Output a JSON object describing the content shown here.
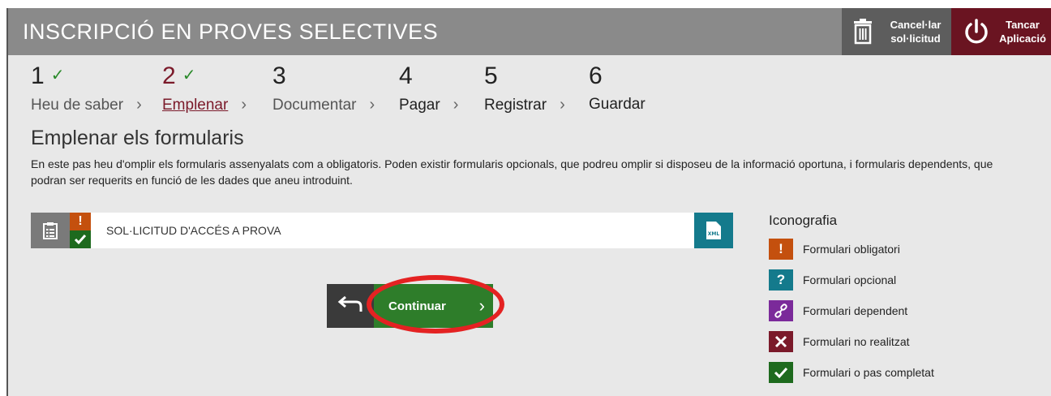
{
  "header": {
    "title": "INSCRIPCIÓ EN PROVES SELECTIVES",
    "cancel_label": "Cancel·lar sol·licitud",
    "close_label": "Tancar Aplicació",
    "colors": {
      "bar": "#8a8a8a",
      "cancel": "#5d5d5d",
      "close": "#6a1421"
    }
  },
  "steps": [
    {
      "number": "1",
      "label": "Heu de saber",
      "completed": true
    },
    {
      "number": "2",
      "label": "Emplenar",
      "completed": true,
      "current": true
    },
    {
      "number": "3",
      "label": "Documentar"
    },
    {
      "number": "4",
      "label": "Pagar"
    },
    {
      "number": "5",
      "label": "Registrar"
    },
    {
      "number": "6",
      "label": "Guardar"
    }
  ],
  "section": {
    "title": "Emplenar els formularis",
    "description": "En este pas heu d'omplir els formularis assenyalats com a obligatoris. Poden existir formularis opcionals, que podreu omplir si disposeu de la informació oportuna, i formularis dependents, que podran ser requerits en funció de les dades que aneu introduint."
  },
  "form": {
    "name": "SOL·LICITUD D'ACCÉS A PROVA",
    "mandatory_mark": "!",
    "xml_label": "XML"
  },
  "nav": {
    "continue_label": "Continuar",
    "continue_color": "#2e7d2a"
  },
  "legend": {
    "title": "Iconografia",
    "items": [
      {
        "icon": "exclamation-icon",
        "color": "#c4500e",
        "label": "Formulari obligatori"
      },
      {
        "icon": "question-icon",
        "color": "#147a8c",
        "label": "Formulari opcional"
      },
      {
        "icon": "link-icon",
        "color": "#7b2a9a",
        "label": "Formulari dependent"
      },
      {
        "icon": "cross-icon",
        "color": "#7b1a2a",
        "label": "Formulari no realitzat"
      },
      {
        "icon": "check-icon",
        "color": "#1e6a1e",
        "label": "Formulari o pas completat"
      }
    ]
  }
}
